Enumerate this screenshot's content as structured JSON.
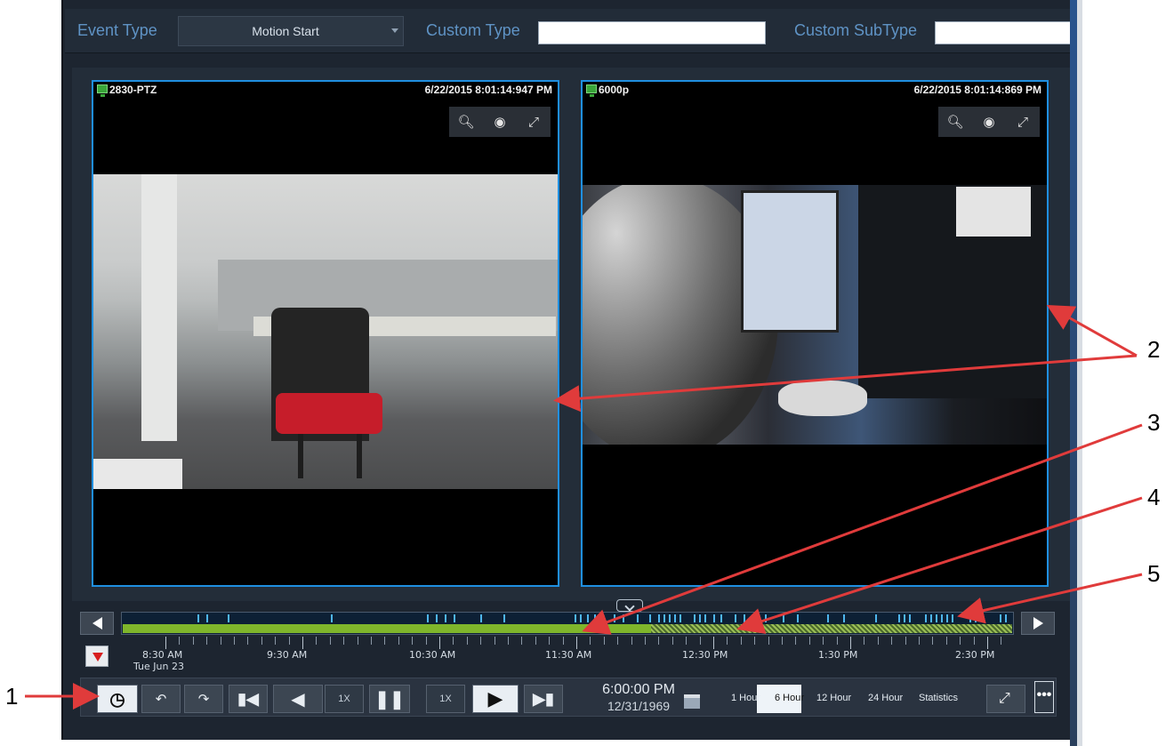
{
  "filter_bar": {
    "event_type_label": "Event Type",
    "event_type_value": "Motion Start",
    "custom_type_label": "Custom Type",
    "custom_type_value": "",
    "custom_subtype_label": "Custom SubType",
    "custom_subtype_value": ""
  },
  "cameras": [
    {
      "name": "2830-PTZ",
      "timestamp": "6/22/2015 8:01:14:947 PM"
    },
    {
      "name": "6000p",
      "timestamp": "6/22/2015 8:01:14:869 PM"
    }
  ],
  "tile_tools": {
    "zoom_icon": "magnifier-icon",
    "snapshot_icon": "camera-icon",
    "fullscreen_icon": "expand-icon"
  },
  "timeline": {
    "labels": [
      {
        "time": "8:30 AM",
        "date": "Tue Jun 23"
      },
      {
        "time": "9:30 AM"
      },
      {
        "time": "10:30 AM"
      },
      {
        "time": "11:30 AM"
      },
      {
        "time": "12:30 PM"
      },
      {
        "time": "1:30 PM"
      },
      {
        "time": "2:30 PM"
      }
    ]
  },
  "controls": {
    "speed_rev": "1X",
    "speed_fwd": "1X",
    "clock_time": "6:00:00 PM",
    "clock_date": "12/31/1969",
    "range_options": [
      "1 Hour",
      "6 Hour",
      "12 Hour",
      "24 Hour",
      "Statistics"
    ],
    "range_selected": "6 Hour",
    "more_label": "•••"
  },
  "callouts": [
    "1",
    "2",
    "3",
    "4",
    "5"
  ],
  "colors": {
    "accent_blue": "#1f8fe0",
    "recording_green": "#7fb62b",
    "arrow_red": "#e03b3b",
    "label_blue": "#5f93c5"
  }
}
